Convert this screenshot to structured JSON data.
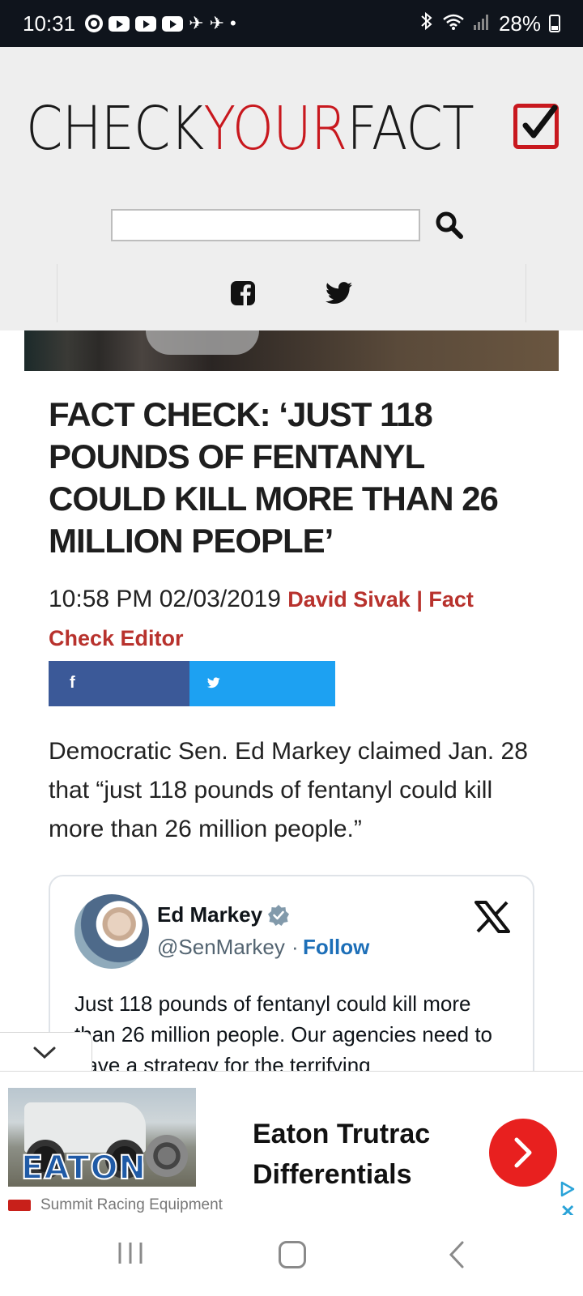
{
  "status_bar": {
    "time": "10:31",
    "battery": "28%"
  },
  "header": {
    "logo_part1": "CHECK",
    "logo_part2": "YOUR",
    "logo_part3": "FACT",
    "search_placeholder": "",
    "icons": [
      "search-icon",
      "facebook-icon",
      "twitter-icon"
    ]
  },
  "article": {
    "headline": "FACT CHECK: ‘JUST 118 POUNDS OF FENTANYL COULD KILL MORE THAN 26 MILLION PEOPLE’",
    "datetime": "10:58 PM 02/03/2019",
    "author": "David Sivak | Fact Check Editor",
    "share_fb": "f",
    "body": "Democratic Sen. Ed Markey claimed Jan. 28 that “just 118 pounds of fentanyl could kill more than 26 million people.”"
  },
  "tweet": {
    "name": "Ed Markey",
    "handle": "@SenMarkey",
    "separator": "·",
    "follow": "Follow",
    "text": "Just 118 pounds of fentanyl could kill more than 26 million people. Our agencies need to have a strategy for the terrifying"
  },
  "ad": {
    "title": "Eaton Trutrac Differentials",
    "sponsor": "Summit Racing Equipment",
    "image_brand": "EATON",
    "close": "✕"
  },
  "colors": {
    "accent_red": "#c8181e",
    "author_red": "#b8322d",
    "facebook_blue": "#3b5998",
    "twitter_blue": "#1da1f2",
    "ad_cta_red": "#e8201f"
  }
}
